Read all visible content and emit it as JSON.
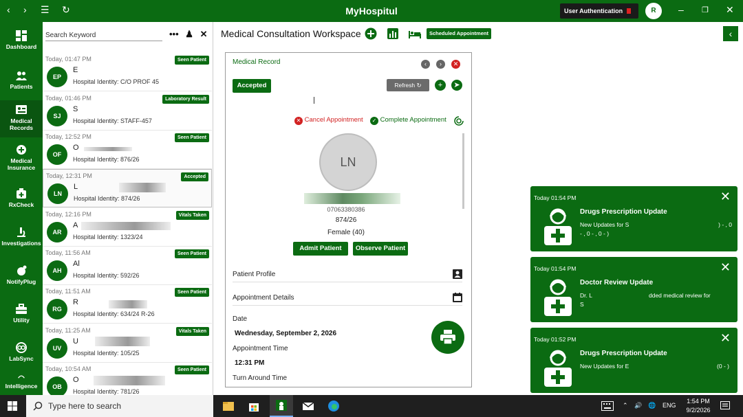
{
  "window": {
    "title": "MyHospitul",
    "user_auth_label": "User Authentication",
    "user_initial": "R"
  },
  "sidebar": {
    "items": [
      {
        "label": "Dashboard"
      },
      {
        "label": "Patients"
      },
      {
        "label": "Medical Records"
      },
      {
        "label": "Medical Insurance"
      },
      {
        "label": "RxCheck"
      },
      {
        "label": "Investigations"
      },
      {
        "label": "NotifyPlug"
      },
      {
        "label": "Utility"
      },
      {
        "label": "LabSync"
      },
      {
        "label": "Intelligence"
      }
    ]
  },
  "patient_list": {
    "search_placeholder": "Search Keyword",
    "entries": [
      {
        "time": "Today,  01:47 PM",
        "status": "Seen Patient",
        "initials": "EP",
        "name": "E",
        "identity": "Hospital Identity: C/O PROF 45"
      },
      {
        "time": "Today,  01:46 PM",
        "status": "Laboratory Result",
        "initials": "SJ",
        "name": "S",
        "identity": "Hospital Identity: STAFF-457"
      },
      {
        "time": "Today,  12:52 PM",
        "status": "Seen Patient",
        "initials": "OF",
        "name": "O",
        "identity": "Hospital Identity: 876/26"
      },
      {
        "time": "Today,  12:31 PM",
        "status": "Accepted",
        "initials": "LN",
        "name": "L",
        "identity": "Hospital Identity: 874/26"
      },
      {
        "time": "Today,  12:16 PM",
        "status": "Vitals Taken",
        "initials": "AR",
        "name": "A",
        "identity": "Hospital Identity: 1323/24"
      },
      {
        "time": "Today,  11:56 AM",
        "status": "Seen Patient",
        "initials": "AH",
        "name": "Al",
        "identity": "Hospital Identity: 592/26"
      },
      {
        "time": "Today,  11:51 AM",
        "status": "Seen Patient",
        "initials": "RG",
        "name": "R",
        "identity": "Hospital Identity: 634/24 R-26"
      },
      {
        "time": "Today,  11:25 AM",
        "status": "Vitals Taken",
        "initials": "UV",
        "name": "U",
        "identity": "Hospital Identity: 105/25"
      },
      {
        "time": "Today,  10:54 AM",
        "status": "Seen Patient",
        "initials": "OB",
        "name": "O",
        "identity": "Hospital Identity: 781/26"
      }
    ]
  },
  "workspace": {
    "title": "Medical Consultation Workspace",
    "scheduled_label": "Scheduled Appointment"
  },
  "record": {
    "title": "Medical Record",
    "accepted_label": "Accepted",
    "refresh_label": "Refresh",
    "cancel_label": "Cancel Appointment",
    "complete_label": "Complete Appointment",
    "avatar_initials": "LN",
    "phone": "07063380386",
    "identity": "874/26",
    "gender_age": "Female (40)",
    "admit_label": "Admit Patient",
    "observe_label": "Observe Patient",
    "profile_label": "Patient Profile",
    "appointment_label": "Appointment Details",
    "date_label": "Date",
    "date_value": "Wednesday, September 2, 2026",
    "appt_time_label": "Appointment Time",
    "appt_time_value": "12:31 PM",
    "turnaround_label": "Turn Around Time"
  },
  "notifications": [
    {
      "time": "Today  01:54 PM",
      "title": "Drugs Prescription Update",
      "body": "New Updates for S",
      "tail": ") - , 0",
      "line2": "- , 0 - , 0 - )"
    },
    {
      "time": "Today  01:54 PM",
      "title": "Doctor Review Update",
      "body": "Dr. L",
      "tail": "dded medical review for",
      "line2": "S"
    },
    {
      "time": "Today  01:52 PM",
      "title": "Drugs Prescription Update",
      "body": "New Updates for E",
      "tail": "(0 - )",
      "line2": ""
    }
  ],
  "taskbar": {
    "search_placeholder": "Type here to search",
    "language": "ENG",
    "time": "1:54 PM",
    "date": "9/2/2026"
  },
  "colors": {
    "brand_green": "#0b6b12",
    "cancel_red": "#d22222"
  }
}
